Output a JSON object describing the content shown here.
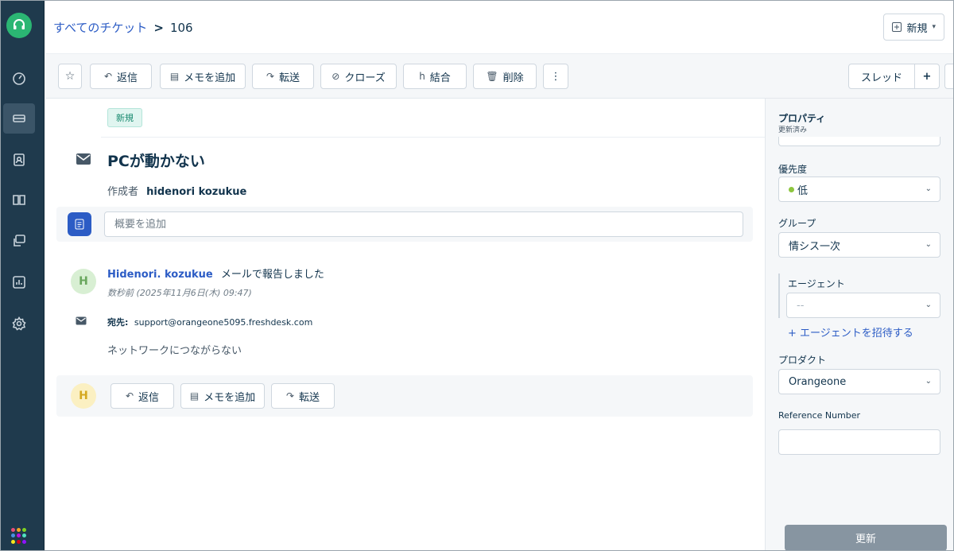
{
  "colors": {
    "brand": "#2bb673",
    "link": "#2c5cc5",
    "sidebar": "#1f3a4d",
    "priority_low": "#8dc63f"
  },
  "sidebar": {
    "items": [
      {
        "icon": "dashboard-icon"
      },
      {
        "icon": "tickets-icon",
        "active": true
      },
      {
        "icon": "contacts-icon"
      },
      {
        "icon": "knowledge-base-icon"
      },
      {
        "icon": "forums-icon"
      },
      {
        "icon": "reports-icon"
      },
      {
        "icon": "settings-icon"
      }
    ]
  },
  "header": {
    "breadcrumb_link": "すべてのチケット",
    "breadcrumb_sep": ">",
    "ticket_id": "106",
    "new_label": "新規"
  },
  "toolbar": {
    "reply": "返信",
    "add_note": "メモを追加",
    "forward": "転送",
    "close": "クローズ",
    "merge": "結合",
    "delete": "削除",
    "more": "⋮",
    "thread": "スレッド",
    "plus": "+"
  },
  "ticket": {
    "status": "新規",
    "title": "PCが動かない",
    "author_prefix": "作成者",
    "author_name": "hidenori kozukue",
    "summary_placeholder": "概要を追加"
  },
  "conversation": {
    "avatar": "H",
    "sender": "Hidenori. kozukue",
    "action": "メールで報告しました",
    "time": "数秒前 (2025年11月6日(木) 09:47)",
    "to_label": "宛先:",
    "to_address": "support@orangeone5095.freshdesk.com",
    "body": "ネットワークにつながらない"
  },
  "reply_bar": {
    "avatar": "H",
    "reply": "返信",
    "add_note": "メモを追加",
    "forward": "転送"
  },
  "properties": {
    "title": "プロパティ",
    "subtitle": "更新済み",
    "priority_label": "優先度",
    "priority_value": "低",
    "group_label": "グループ",
    "group_value": "情シス一次",
    "agent_label": "エージェント",
    "agent_value": "--",
    "invite_agent": "+ エージェントを招待する",
    "product_label": "プロダクト",
    "product_value": "Orangeone",
    "reference_label": "Reference Number",
    "reference_value": "",
    "update_button": "更新"
  }
}
